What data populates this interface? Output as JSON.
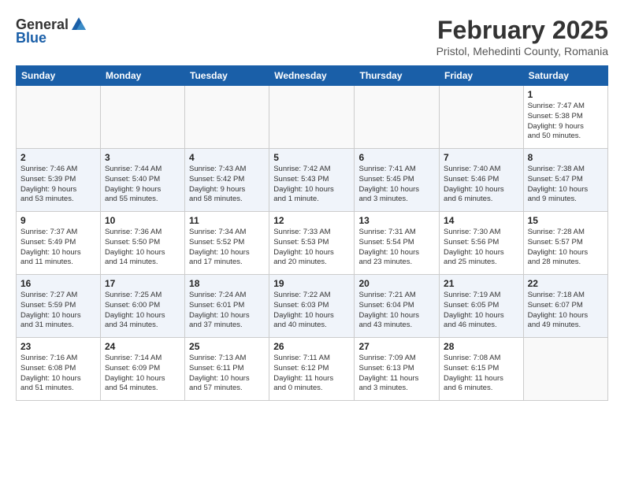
{
  "header": {
    "logo_general": "General",
    "logo_blue": "Blue",
    "title": "February 2025",
    "subtitle": "Pristol, Mehedinti County, Romania"
  },
  "days_of_week": [
    "Sunday",
    "Monday",
    "Tuesday",
    "Wednesday",
    "Thursday",
    "Friday",
    "Saturday"
  ],
  "weeks": [
    [
      {
        "day": "",
        "info": ""
      },
      {
        "day": "",
        "info": ""
      },
      {
        "day": "",
        "info": ""
      },
      {
        "day": "",
        "info": ""
      },
      {
        "day": "",
        "info": ""
      },
      {
        "day": "",
        "info": ""
      },
      {
        "day": "1",
        "info": "Sunrise: 7:47 AM\nSunset: 5:38 PM\nDaylight: 9 hours\nand 50 minutes."
      }
    ],
    [
      {
        "day": "2",
        "info": "Sunrise: 7:46 AM\nSunset: 5:39 PM\nDaylight: 9 hours\nand 53 minutes."
      },
      {
        "day": "3",
        "info": "Sunrise: 7:44 AM\nSunset: 5:40 PM\nDaylight: 9 hours\nand 55 minutes."
      },
      {
        "day": "4",
        "info": "Sunrise: 7:43 AM\nSunset: 5:42 PM\nDaylight: 9 hours\nand 58 minutes."
      },
      {
        "day": "5",
        "info": "Sunrise: 7:42 AM\nSunset: 5:43 PM\nDaylight: 10 hours\nand 1 minute."
      },
      {
        "day": "6",
        "info": "Sunrise: 7:41 AM\nSunset: 5:45 PM\nDaylight: 10 hours\nand 3 minutes."
      },
      {
        "day": "7",
        "info": "Sunrise: 7:40 AM\nSunset: 5:46 PM\nDaylight: 10 hours\nand 6 minutes."
      },
      {
        "day": "8",
        "info": "Sunrise: 7:38 AM\nSunset: 5:47 PM\nDaylight: 10 hours\nand 9 minutes."
      }
    ],
    [
      {
        "day": "9",
        "info": "Sunrise: 7:37 AM\nSunset: 5:49 PM\nDaylight: 10 hours\nand 11 minutes."
      },
      {
        "day": "10",
        "info": "Sunrise: 7:36 AM\nSunset: 5:50 PM\nDaylight: 10 hours\nand 14 minutes."
      },
      {
        "day": "11",
        "info": "Sunrise: 7:34 AM\nSunset: 5:52 PM\nDaylight: 10 hours\nand 17 minutes."
      },
      {
        "day": "12",
        "info": "Sunrise: 7:33 AM\nSunset: 5:53 PM\nDaylight: 10 hours\nand 20 minutes."
      },
      {
        "day": "13",
        "info": "Sunrise: 7:31 AM\nSunset: 5:54 PM\nDaylight: 10 hours\nand 23 minutes."
      },
      {
        "day": "14",
        "info": "Sunrise: 7:30 AM\nSunset: 5:56 PM\nDaylight: 10 hours\nand 25 minutes."
      },
      {
        "day": "15",
        "info": "Sunrise: 7:28 AM\nSunset: 5:57 PM\nDaylight: 10 hours\nand 28 minutes."
      }
    ],
    [
      {
        "day": "16",
        "info": "Sunrise: 7:27 AM\nSunset: 5:59 PM\nDaylight: 10 hours\nand 31 minutes."
      },
      {
        "day": "17",
        "info": "Sunrise: 7:25 AM\nSunset: 6:00 PM\nDaylight: 10 hours\nand 34 minutes."
      },
      {
        "day": "18",
        "info": "Sunrise: 7:24 AM\nSunset: 6:01 PM\nDaylight: 10 hours\nand 37 minutes."
      },
      {
        "day": "19",
        "info": "Sunrise: 7:22 AM\nSunset: 6:03 PM\nDaylight: 10 hours\nand 40 minutes."
      },
      {
        "day": "20",
        "info": "Sunrise: 7:21 AM\nSunset: 6:04 PM\nDaylight: 10 hours\nand 43 minutes."
      },
      {
        "day": "21",
        "info": "Sunrise: 7:19 AM\nSunset: 6:05 PM\nDaylight: 10 hours\nand 46 minutes."
      },
      {
        "day": "22",
        "info": "Sunrise: 7:18 AM\nSunset: 6:07 PM\nDaylight: 10 hours\nand 49 minutes."
      }
    ],
    [
      {
        "day": "23",
        "info": "Sunrise: 7:16 AM\nSunset: 6:08 PM\nDaylight: 10 hours\nand 51 minutes."
      },
      {
        "day": "24",
        "info": "Sunrise: 7:14 AM\nSunset: 6:09 PM\nDaylight: 10 hours\nand 54 minutes."
      },
      {
        "day": "25",
        "info": "Sunrise: 7:13 AM\nSunset: 6:11 PM\nDaylight: 10 hours\nand 57 minutes."
      },
      {
        "day": "26",
        "info": "Sunrise: 7:11 AM\nSunset: 6:12 PM\nDaylight: 11 hours\nand 0 minutes."
      },
      {
        "day": "27",
        "info": "Sunrise: 7:09 AM\nSunset: 6:13 PM\nDaylight: 11 hours\nand 3 minutes."
      },
      {
        "day": "28",
        "info": "Sunrise: 7:08 AM\nSunset: 6:15 PM\nDaylight: 11 hours\nand 6 minutes."
      },
      {
        "day": "",
        "info": ""
      }
    ]
  ]
}
